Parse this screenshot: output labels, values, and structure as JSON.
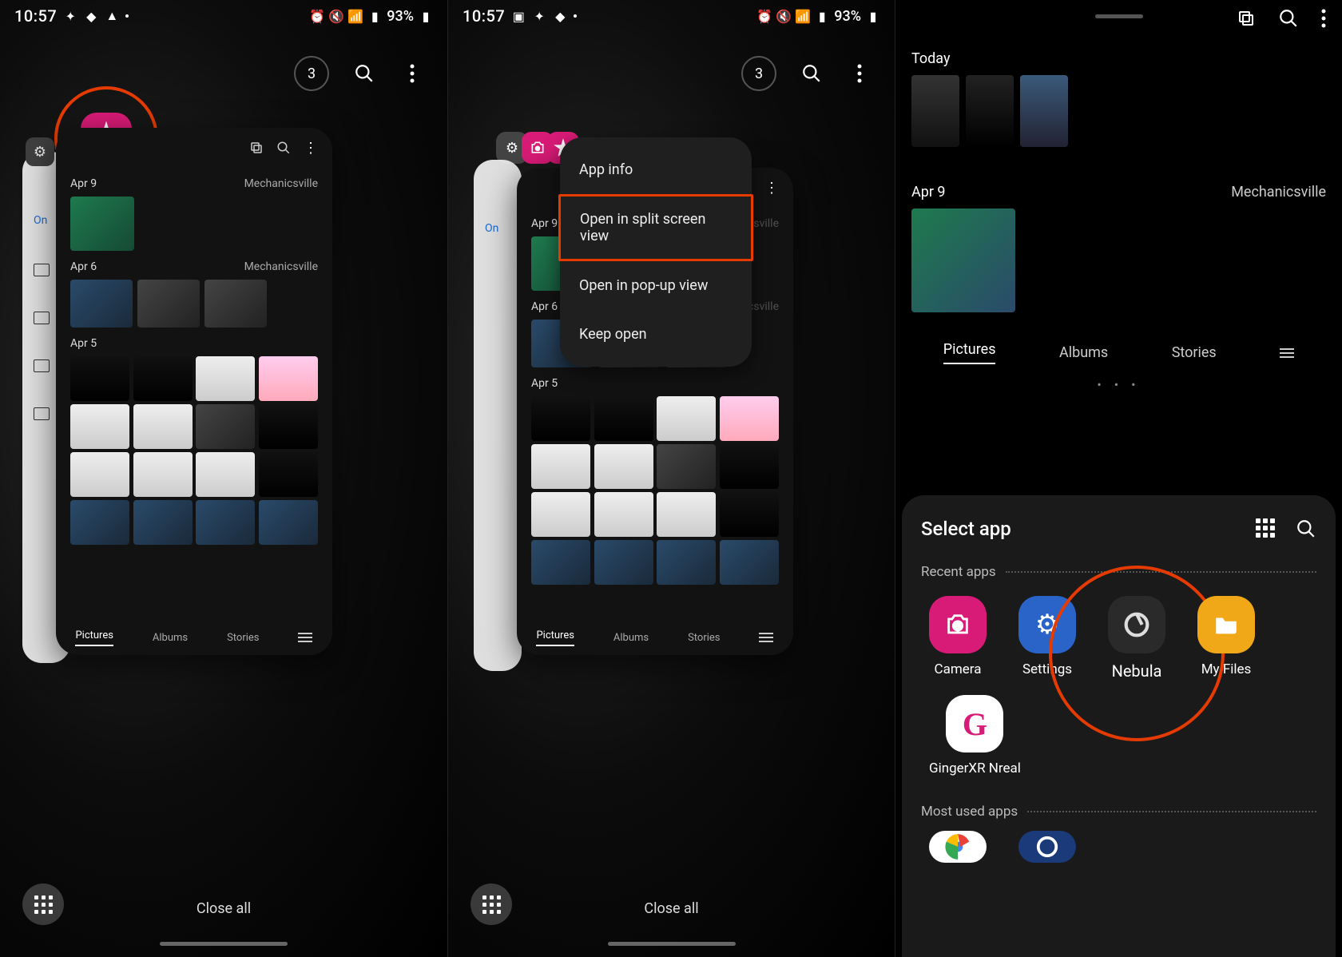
{
  "status": {
    "time": "10:57",
    "battery": "93%"
  },
  "recents": {
    "count": "3",
    "close_all": "Close all"
  },
  "card": {
    "date1": "Apr 9",
    "loc1": "Mechanicsville",
    "date2": "Apr 6",
    "loc2": "Mechanicsville",
    "date3": "Apr 5",
    "tab_pictures": "Pictures",
    "tab_albums": "Albums",
    "tab_stories": "Stories"
  },
  "bgcard": {
    "on": "On"
  },
  "ctx": {
    "app_info": "App info",
    "split": "Open in split screen view",
    "popup": "Open in pop-up view",
    "keep": "Keep open"
  },
  "p3": {
    "today": "Today",
    "apr9": "Apr 9",
    "where": "Mechanicsville",
    "pictures": "Pictures",
    "albums": "Albums",
    "stories": "Stories",
    "select_app": "Select app",
    "recent_apps": "Recent apps",
    "most_used": "Most used apps",
    "camera": "Camera",
    "settings": "Settings",
    "nebula": "Nebula",
    "myfiles": "My Files",
    "ginger": "GingerXR Nreal"
  }
}
